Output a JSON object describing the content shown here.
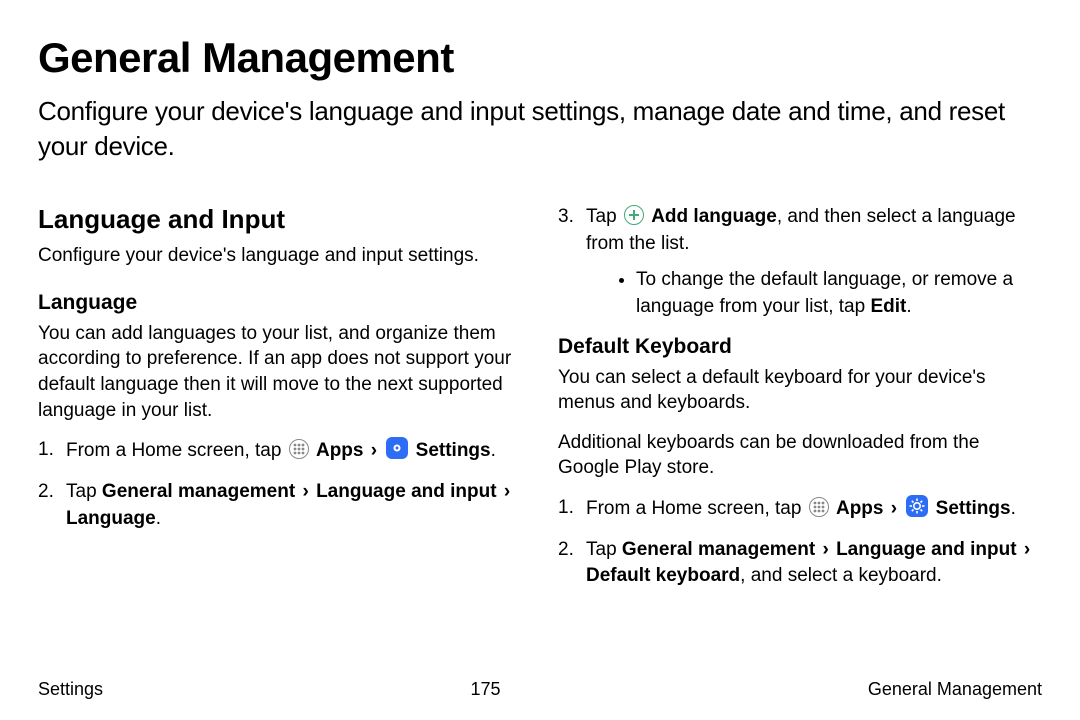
{
  "title": "General Management",
  "subtitle": "Configure your device's language and input settings, manage date and time, and reset your device.",
  "sectionHeading": "Language and Input",
  "sectionDesc": "Configure your device's language and input settings.",
  "lang": {
    "h": "Language",
    "p": "You can add languages to your list, and organize them according to preference. If an app does not support your default language then it will move to the next supported language in your list.",
    "step1_a": "From a Home screen, tap ",
    "apps": "Apps",
    "settings": "Settings",
    "step2_a": "Tap ",
    "step2_b": "General management",
    "step2_c": "Language and input",
    "step2_d": "Language",
    "step3_a": "Tap ",
    "step3_b": "Add language",
    "step3_c": ", and then select a language from the list.",
    "bullet_a": "To change the default language, or remove a language from your list, tap ",
    "bullet_b": "Edit"
  },
  "kb": {
    "h": "Default Keyboard",
    "p1": "You can select a default keyboard for your device's menus and keyboards.",
    "p2": "Additional keyboards can be downloaded from the Google Play store.",
    "step1_a": "From a Home screen, tap ",
    "step2_a": "Tap ",
    "step2_b": "General management",
    "step2_c": "Language and input",
    "step2_d": "Default keyboard",
    "step2_e": ", and select a keyboard."
  },
  "footer": {
    "left": "Settings",
    "center": "175",
    "right": "General Management"
  }
}
